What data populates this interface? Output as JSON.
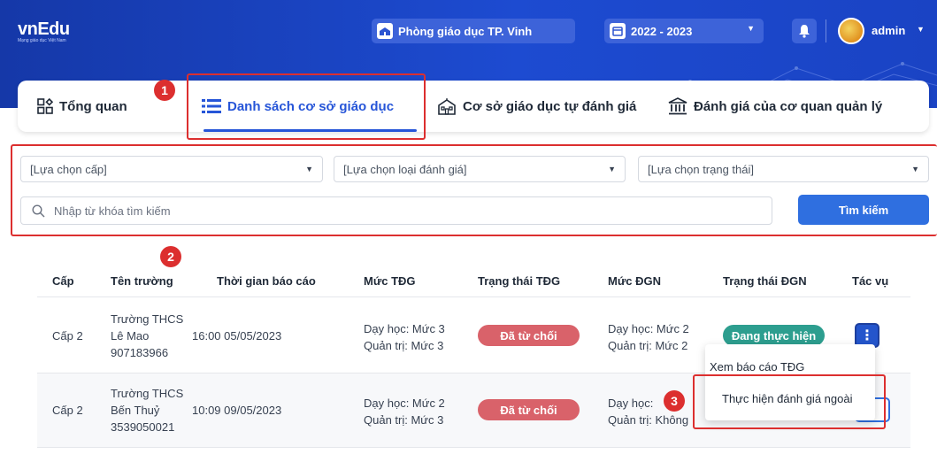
{
  "header": {
    "logo": "vnEdu",
    "logo_tagline": "Mạng giáo dục Việt Nam",
    "office": "Phòng giáo dục TP. Vinh",
    "year": "2022 - 2023",
    "user": "admin"
  },
  "tabs": [
    {
      "label": "Tổng quan",
      "icon": "overview-grid-icon"
    },
    {
      "label": "Danh sách cơ sở giáo dục",
      "icon": "list-icon",
      "active": true
    },
    {
      "label": "Cơ sở giáo dục tự đánh giá",
      "icon": "school-building-icon"
    },
    {
      "label": "Đánh giá của cơ quan quản lý",
      "icon": "government-building-icon"
    }
  ],
  "filters": {
    "level_placeholder": "[Lựa chọn cấp]",
    "type_placeholder": "[Lựa chọn loại đánh giá]",
    "status_placeholder": "[Lựa chọn trạng thái]",
    "search_placeholder": "Nhập từ khóa tìm kiếm",
    "search_button": "Tìm kiếm"
  },
  "annotations": [
    "1",
    "2",
    "3"
  ],
  "table": {
    "columns": [
      "Cấp",
      "Tên trường",
      "Thời gian báo cáo",
      "Mức TĐG",
      "Trạng thái TĐG",
      "Mức ĐGN",
      "Trạng thái ĐGN",
      "Tác vụ"
    ],
    "rows": [
      {
        "level": "Cấp 2",
        "school": [
          "Trường THCS",
          "Lê Mao",
          "907183966"
        ],
        "time": "16:00 05/05/2023",
        "tdg": [
          "Dạy học: Mức 3",
          "Quản trị: Mức 3"
        ],
        "tdg_status": "Đã từ chối",
        "dgn": [
          "Dạy học: Mức 2",
          "Quản trị: Mức 2"
        ],
        "dgn_status": "Đang thực hiện"
      },
      {
        "level": "Cấp 2",
        "school": [
          "Trường THCS",
          "Bến Thuỷ",
          "3539050021"
        ],
        "time": "10:09 09/05/2023",
        "tdg": [
          "Dạy học: Mức 2",
          "Quản trị: Mức 3"
        ],
        "tdg_status": "Đã từ chối",
        "dgn": [
          "Dạy học:",
          "Quản trị: Không"
        ],
        "dgn_status": ""
      }
    ]
  },
  "action_menu": {
    "items": [
      "Xem báo cáo TĐG",
      "Thực hiện đánh giá ngoài"
    ]
  },
  "colors": {
    "header_bg": "#1d4bd1",
    "accent": "#2655d8",
    "refused": "#d9626a",
    "in_progress": "#2d9e8f",
    "annotation": "#dc2f2f"
  }
}
